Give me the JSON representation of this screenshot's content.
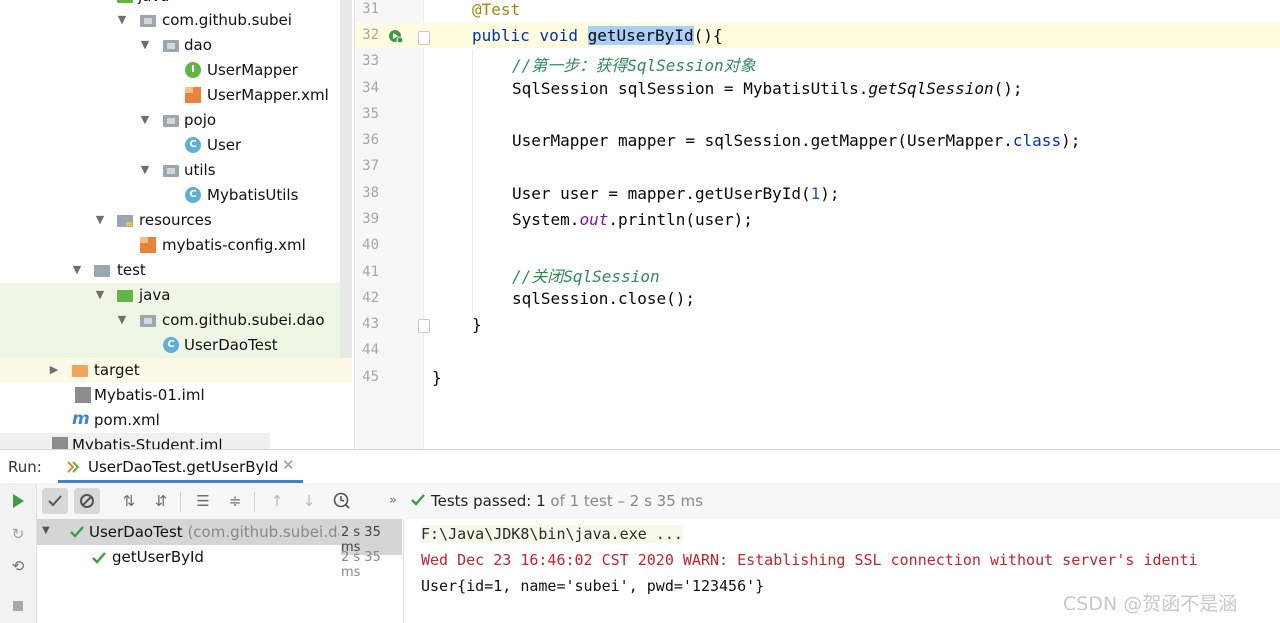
{
  "project_tree": {
    "top_partial": "java",
    "items": [
      {
        "label": "com.github.subei"
      },
      {
        "label": "dao"
      },
      {
        "label": "UserMapper",
        "badge": "I"
      },
      {
        "label": "UserMapper.xml"
      },
      {
        "label": "pojo"
      },
      {
        "label": "User",
        "badge": "C"
      },
      {
        "label": "utils"
      },
      {
        "label": "MybatisUtils",
        "badge": "C"
      },
      {
        "label": "resources"
      },
      {
        "label": "mybatis-config.xml"
      },
      {
        "label": "test"
      },
      {
        "label": "java"
      },
      {
        "label": "com.github.subei.dao"
      },
      {
        "label": "UserDaoTest",
        "badge": "C"
      },
      {
        "label": "target"
      },
      {
        "label": "Mybatis-01.iml"
      },
      {
        "label": "pom.xml",
        "badge": "m"
      },
      {
        "label": "Mybatis-Student.iml"
      }
    ]
  },
  "editor": {
    "line_numbers": [
      "31",
      "32",
      "33",
      "34",
      "35",
      "36",
      "37",
      "38",
      "39",
      "40",
      "41",
      "42",
      "43",
      "44",
      "45"
    ],
    "code": {
      "l31": "@Test",
      "l32_kw1": "public",
      "l32_kw2": "void",
      "l32_sel": "getUserById",
      "l32_rest": "(){",
      "l33": "//第一步：获得SqlSession对象",
      "l34_a": "SqlSession sqlSession = MybatisUtils.",
      "l34_b": "getSqlSession",
      "l34_c": "();",
      "l36_a": "UserMapper mapper = sqlSession.getMapper(UserMapper.",
      "l36_kw": "class",
      "l36_c": ");",
      "l38_a": "User user = mapper.getUserById(",
      "l38_num": "1",
      "l38_c": ");",
      "l39_a": "System.",
      "l39_fld": "out",
      "l39_c": ".println(user);",
      "l41": "//关闭SqlSession",
      "l42": "sqlSession.close();",
      "l43": "}",
      "l45": "}"
    }
  },
  "run_panel": {
    "run_label": "Run:",
    "tab_label": "UserDaoTest.getUserById",
    "status_prefix": "Tests passed:",
    "status_count": "1",
    "status_suffix": "of 1 test – 2 s 35 ms",
    "tests": [
      {
        "name": "UserDaoTest",
        "detail": "(com.github.subei.da",
        "time": "2 s 35 ms"
      },
      {
        "name": "getUserById",
        "detail": "",
        "time": "2 s 35 ms"
      }
    ],
    "console": [
      "F:\\Java\\JDK8\\bin\\java.exe ...",
      "Wed Dec 23 16:46:02 CST 2020 WARN: Establishing SSL connection without server's identi",
      "User{id=1, name='subei', pwd='123456'}"
    ]
  },
  "watermark": "CSDN @贺函不是涵",
  "colors": {
    "pass_green": "#3d9b48",
    "warn_red": "#c7222d",
    "selection": "#a9d1f7",
    "keyword": "#0033b3"
  }
}
